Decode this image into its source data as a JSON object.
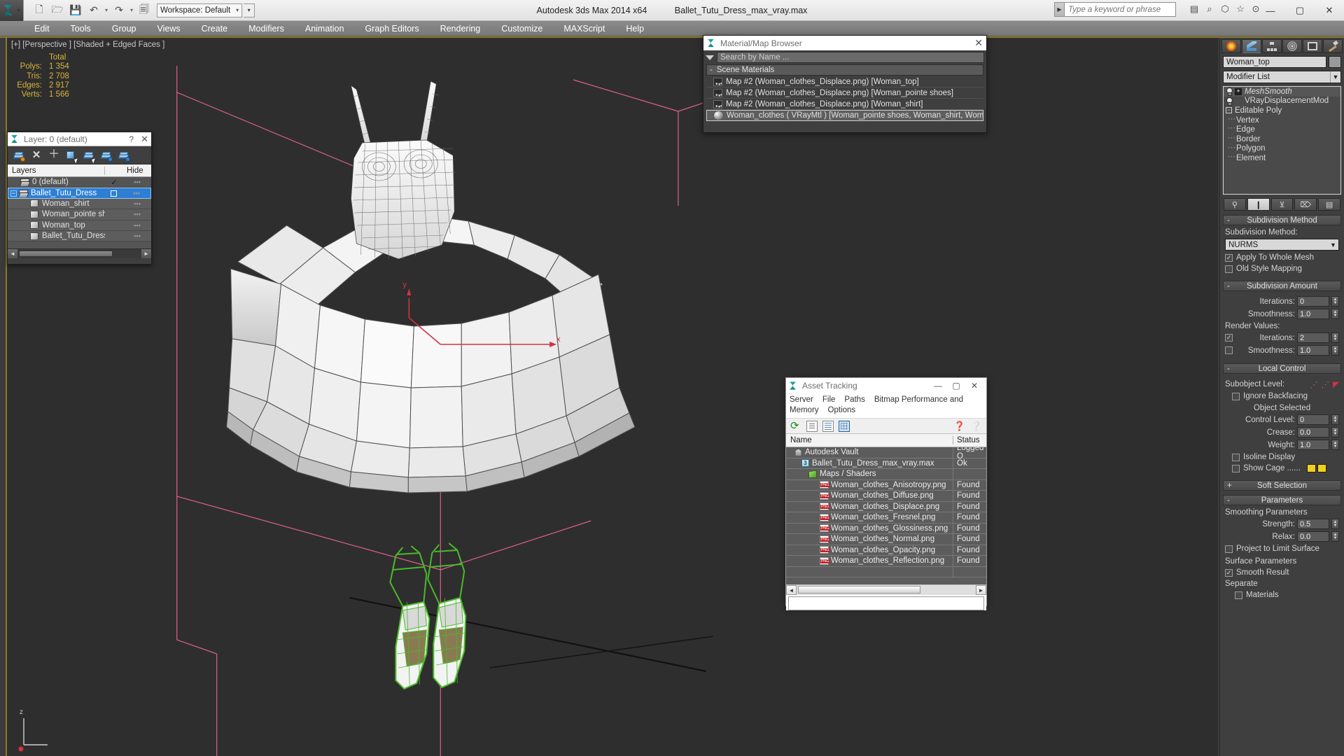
{
  "titlebar": {
    "app_title": "Autodesk 3ds Max  2014 x64",
    "file_name": "Ballet_Tutu_Dress_max_vray.max",
    "workspace": "Workspace: Default",
    "search_placeholder": "Type a keyword or phrase",
    "quick_access": [
      "new-icon",
      "open-icon",
      "save-icon",
      "undo-icon",
      "redo-icon",
      "set-project-icon"
    ],
    "window_buttons": [
      "minimize",
      "maximize",
      "close"
    ]
  },
  "menubar": {
    "items": [
      "Edit",
      "Tools",
      "Group",
      "Views",
      "Create",
      "Modifiers",
      "Animation",
      "Graph Editors",
      "Rendering",
      "Customize",
      "MAXScript",
      "Help"
    ]
  },
  "viewport": {
    "label": "[+] [Perspective ] [Shaded + Edged Faces ]",
    "stats_header": "Total",
    "stats": [
      {
        "key": "Polys:",
        "value": "1 354"
      },
      {
        "key": "Tris:",
        "value": "2 708"
      },
      {
        "key": "Edges:",
        "value": "2 917"
      },
      {
        "key": "Verts:",
        "value": "1 566"
      }
    ],
    "axis_labels": {
      "x": "x",
      "y": "y",
      "z": "z"
    }
  },
  "layer_dialog": {
    "title": "Layer: 0 (default)",
    "help_label": "?",
    "close_label": "✕",
    "columns": [
      "Layers",
      "Hide"
    ],
    "toolbar": [
      "new-layer-icon",
      "delete-layer-icon",
      "add-layer-icon",
      "select-objects-icon",
      "select-highlighted-icon",
      "highlight-selected-icon",
      "layer-properties-icon"
    ],
    "rows": [
      {
        "name": "0 (default)",
        "indent": 0,
        "icon": "layer-icon",
        "state": "check",
        "expander": false,
        "selected": false
      },
      {
        "name": "Ballet_Tutu_Dress",
        "indent": 0,
        "icon": "layer-icon",
        "state": "box",
        "expander": true,
        "selected": true
      },
      {
        "name": "Woman_shirt",
        "indent": 1,
        "icon": "object-icon",
        "state": "",
        "expander": false,
        "selected": false
      },
      {
        "name": "Woman_pointe shoes",
        "indent": 1,
        "icon": "object-icon",
        "state": "",
        "expander": false,
        "selected": false
      },
      {
        "name": "Woman_top",
        "indent": 1,
        "icon": "object-icon",
        "state": "",
        "expander": false,
        "selected": false
      },
      {
        "name": "Ballet_Tutu_Dress",
        "indent": 1,
        "icon": "object-icon",
        "state": "",
        "expander": false,
        "selected": false
      }
    ]
  },
  "material_browser": {
    "title": "Material/Map Browser",
    "close_label": "✕",
    "search_placeholder": "Search by Name ...",
    "group_label": "Scene Materials",
    "group_sign": "-",
    "items": [
      {
        "label": "Map #2 (Woman_clothes_Displace.png) [Woman_top]",
        "icon": "map-icon",
        "selected": false
      },
      {
        "label": "Map #2 (Woman_clothes_Displace.png) [Woman_pointe shoes]",
        "icon": "map-icon",
        "selected": false
      },
      {
        "label": "Map #2 (Woman_clothes_Displace.png) [Woman_shirt]",
        "icon": "map-icon",
        "selected": false
      },
      {
        "label": "Woman_clothes  ( VRayMtl ) [Woman_pointe shoes, Woman_shirt, Woman_top]",
        "icon": "material-sphere-icon",
        "selected": true
      }
    ]
  },
  "asset_tracking": {
    "title": "Asset Tracking",
    "window_buttons": [
      "minimize",
      "maximize",
      "close"
    ],
    "menu": [
      "Server",
      "File",
      "Paths",
      "Bitmap Performance and Memory",
      "Options"
    ],
    "toolbar": [
      "refresh-icon",
      "list-view-icon",
      "report-view-icon",
      "grid-view-icon",
      "help-icon",
      "context-help-icon"
    ],
    "columns": [
      "Name",
      "Status"
    ],
    "rows": [
      {
        "name": "Autodesk Vault",
        "status": "Logged O",
        "indent": 0,
        "icon": "vault-icon"
      },
      {
        "name": "Ballet_Tutu_Dress_max_vray.max",
        "status": "Ok",
        "indent": 1,
        "icon": "max-file-icon"
      },
      {
        "name": "Maps / Shaders",
        "status": "",
        "indent": 2,
        "icon": "maps-icon"
      },
      {
        "name": "Woman_clothes_Anisotropy.png",
        "status": "Found",
        "indent": 3,
        "icon": "png-icon"
      },
      {
        "name": "Woman_clothes_Diffuse.png",
        "status": "Found",
        "indent": 3,
        "icon": "png-icon"
      },
      {
        "name": "Woman_clothes_Displace.png",
        "status": "Found",
        "indent": 3,
        "icon": "png-icon"
      },
      {
        "name": "Woman_clothes_Fresnel.png",
        "status": "Found",
        "indent": 3,
        "icon": "png-icon"
      },
      {
        "name": "Woman_clothes_Glossiness.png",
        "status": "Found",
        "indent": 3,
        "icon": "png-icon"
      },
      {
        "name": "Woman_clothes_Normal.png",
        "status": "Found",
        "indent": 3,
        "icon": "png-icon"
      },
      {
        "name": "Woman_clothes_Opacity.png",
        "status": "Found",
        "indent": 3,
        "icon": "png-icon"
      },
      {
        "name": "Woman_clothes_Reflection.png",
        "status": "Found",
        "indent": 3,
        "icon": "png-icon"
      }
    ]
  },
  "command_panel": {
    "tabs": [
      "create-tab",
      "modify-tab",
      "hierarchy-tab",
      "motion-tab",
      "display-tab",
      "utilities-tab"
    ],
    "active_tab_index": 1,
    "object_name": "Woman_top",
    "modifier_list_label": "Modifier List",
    "modifier_stack": [
      {
        "label": "MeshSmooth",
        "italic": true,
        "has_plus": true,
        "bulb": true,
        "indent": 0
      },
      {
        "label": "VRayDisplacementMod",
        "italic": false,
        "has_plus": false,
        "bulb": true,
        "indent": 1
      },
      {
        "label": "Editable Poly",
        "italic": false,
        "has_minus": true,
        "bulb": false,
        "indent": 0
      },
      {
        "label": "Vertex",
        "sub": true
      },
      {
        "label": "Edge",
        "sub": true
      },
      {
        "label": "Border",
        "sub": true
      },
      {
        "label": "Polygon",
        "sub": true
      },
      {
        "label": "Element",
        "sub": true
      }
    ],
    "stack_buttons": [
      "pin-stack-icon",
      "show-end-result-icon",
      "make-unique-icon",
      "remove-modifier-icon",
      "configure-sets-icon"
    ],
    "subdivision_method": {
      "rollout_title": "Subdivision Method",
      "sign": "-",
      "label": "Subdivision Method:",
      "value": "NURMS",
      "options": [
        {
          "label": "Apply To Whole Mesh",
          "checked": true
        },
        {
          "label": "Old Style Mapping",
          "checked": false
        }
      ]
    },
    "subdivision_amount": {
      "rollout_title": "Subdivision Amount",
      "sign": "-",
      "iterations_label": "Iterations:",
      "iterations_value": "0",
      "smoothness_label": "Smoothness:",
      "smoothness_value": "1.0",
      "render_values_label": "Render Values:",
      "render_iterations_label": "Iterations:",
      "render_iterations_value": "2",
      "render_iterations_checked": true,
      "render_smoothness_label": "Smoothness:",
      "render_smoothness_value": "1.0",
      "render_smoothness_checked": false
    },
    "local_control": {
      "rollout_title": "Local Control",
      "sign": "-",
      "subobject_label": "Subobject Level:",
      "ignore_backfacing_label": "Ignore Backfacing",
      "ignore_backfacing_checked": false,
      "object_selected_label": "Object Selected",
      "control_level_label": "Control Level:",
      "control_level_value": "0",
      "crease_label": "Crease:",
      "crease_value": "0.0",
      "weight_label": "Weight:",
      "weight_value": "1.0",
      "isoline_label": "Isoline Display",
      "isoline_checked": false,
      "showcage_label": "Show Cage ......",
      "showcage_checked": false
    },
    "soft_selection": {
      "rollout_title": "Soft Selection",
      "sign": "+"
    },
    "parameters": {
      "rollout_title": "Parameters",
      "sign": "-",
      "smoothing_group_label": "Smoothing Parameters",
      "strength_label": "Strength:",
      "strength_value": "0.5",
      "relax_label": "Relax:",
      "relax_value": "0.0",
      "project_label": "Project to Limit Surface",
      "project_checked": false,
      "surface_group_label": "Surface Parameters",
      "smooth_result_label": "Smooth Result",
      "smooth_result_checked": true,
      "separate_label": "Separate",
      "materials_label": "Materials",
      "materials_checked": false
    }
  }
}
